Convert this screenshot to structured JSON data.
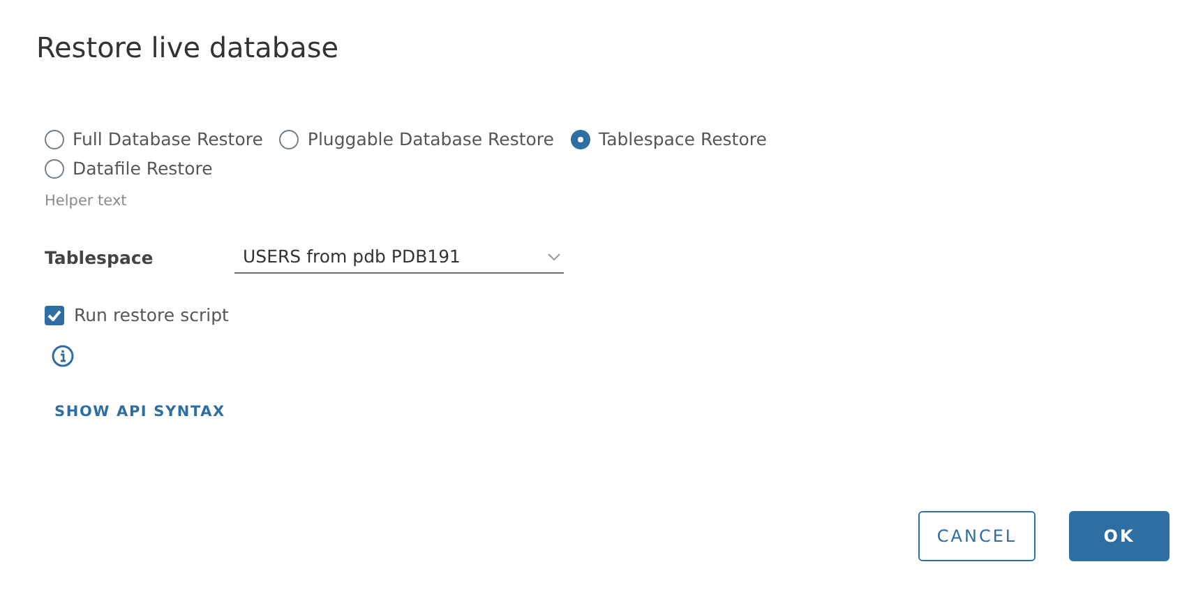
{
  "dialog": {
    "title": "Restore live database"
  },
  "restore_type": {
    "options": [
      {
        "label": "Full Database Restore",
        "selected": false
      },
      {
        "label": "Pluggable Database Restore",
        "selected": false
      },
      {
        "label": "Tablespace Restore",
        "selected": true
      },
      {
        "label": "Datafile Restore",
        "selected": false
      }
    ],
    "helper": "Helper text"
  },
  "tablespace": {
    "label": "Tablespace",
    "value": "USERS from pdb PDB191"
  },
  "run_restore_script": {
    "label": "Run restore script",
    "checked": true
  },
  "link": "SHOW API SYNTAX",
  "buttons": [
    {
      "label": "CANCEL",
      "kind": "outline"
    },
    {
      "label": "OK",
      "kind": "primary"
    }
  ]
}
